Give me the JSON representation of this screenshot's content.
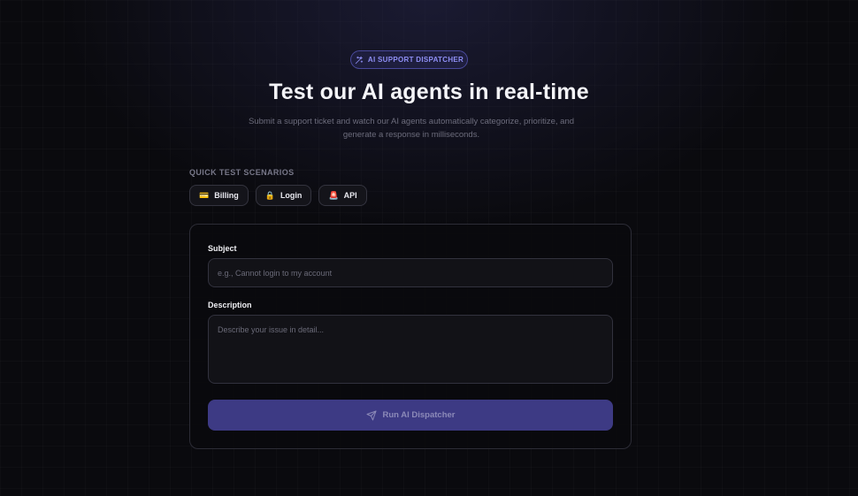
{
  "badge": {
    "label": "AI SUPPORT DISPATCHER",
    "icon": "sparkles-icon"
  },
  "hero": {
    "title": "Test our AI agents in real-time",
    "subtitle_line1": "Submit a support ticket and watch our AI agents automatically categorize, prioritize, and",
    "subtitle_line2": "generate a response in milliseconds."
  },
  "quick_test": {
    "label": "QUICK TEST SCENARIOS",
    "chips": [
      {
        "icon": "💳",
        "label": "Billing"
      },
      {
        "icon": "🔒",
        "label": "Login"
      },
      {
        "icon": "🚨",
        "label": "API"
      }
    ]
  },
  "form": {
    "subject_label": "Subject",
    "subject_placeholder": "e.g., Cannot login to my account",
    "description_label": "Description",
    "description_placeholder": "Describe your issue in detail...",
    "submit_label": "Run AI Dispatcher"
  },
  "colors": {
    "background": "#0a0a0e",
    "accent": "#3d3a84",
    "badge_text": "#8f8ff5"
  }
}
